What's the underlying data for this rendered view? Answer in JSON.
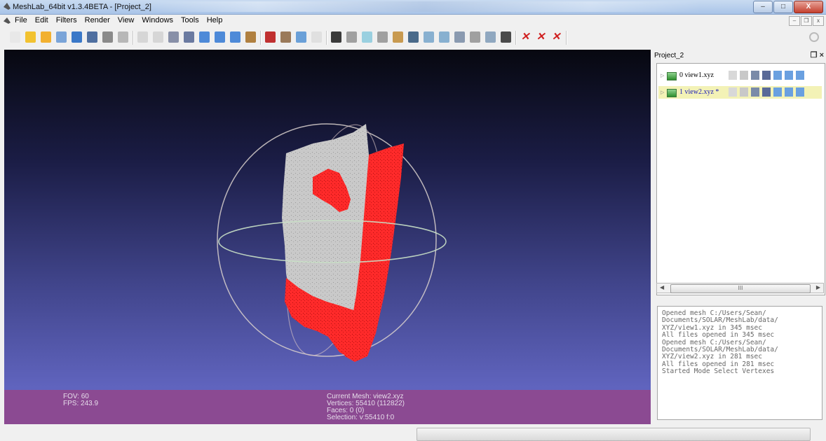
{
  "window": {
    "title": "MeshLab_64bit v1.3.4BETA - [Project_2]"
  },
  "window_buttons": [
    "–",
    "□",
    "X"
  ],
  "menu": {
    "items": [
      "File",
      "Edit",
      "Filters",
      "Render",
      "View",
      "Windows",
      "Tools",
      "Help"
    ]
  },
  "mdi_buttons": [
    "–",
    "❐",
    "x"
  ],
  "toolbar_icons": [
    "new-project-icon",
    "open-project-icon",
    "open-mesh-icon",
    "reload-icon",
    "save-icon",
    "snapshot-icon",
    "layers-icon",
    "toggle-log-icon",
    "bounding-box-icon",
    "points-icon",
    "wireframe-icon",
    "hidden-lines-icon",
    "flat-icon",
    "flat-lines-icon",
    "smooth-icon",
    "light-icon",
    "color-icon",
    "texture-icon",
    "fullscreen-icon",
    "annotation-icon",
    "select-faces-icon",
    "paint-icon",
    "measure-icon",
    "align-icon",
    "z-painting-icon",
    "texture-param-icon",
    "select-vertices-icon",
    "select-connected-icon",
    "manipulator-icon",
    "pick-points-icon",
    "point-editor-icon",
    "info-icon",
    "delete-faces-icon",
    "delete-vertices-icon",
    "delete-selection-icon",
    "search-icon"
  ],
  "viewport": {
    "info_left": [
      "FOV: 60",
      "FPS:  243.9"
    ],
    "info_center": [
      "Current Mesh: view2.xyz",
      "Vertices: 55410 (112822)",
      "Faces: 0 (0)",
      "Selection: v:55410 f:0"
    ]
  },
  "panel": {
    "title": "Project_2",
    "controls": "❒ ×",
    "layers": [
      {
        "index": "0",
        "name": "view1.xyz",
        "selected": false
      },
      {
        "index": "1",
        "name": "view2.xyz *",
        "selected": true
      }
    ],
    "scroll_thumb": "III",
    "log": [
      "Opened mesh C:/Users/Sean/",
      "Documents/SOLAR/MeshLab/data/",
      "XYZ/view1.xyz in 345 msec",
      "All files opened in 345 msec",
      "Opened mesh C:/Users/Sean/",
      "Documents/SOLAR/MeshLab/data/",
      "XYZ/view2.xyz in 281 msec",
      "All files opened in 281 msec",
      "Started Mode Select Vertexes"
    ]
  },
  "colors": {
    "selection_red": "#ff1a1a",
    "mesh_gray": "#c9c9c9",
    "info_bar": "#8b4a92",
    "trackball_ring": "#d8d0cc"
  }
}
